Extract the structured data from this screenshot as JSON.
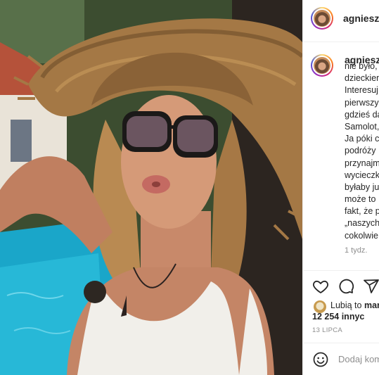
{
  "post": {
    "username": "agnieszka",
    "caption_lines": [
      "nie było,",
      "dzieckiem",
      "Interesuj",
      "pierwszy",
      "gdzieś da",
      "Samolot,",
      "Ja póki c",
      "podróży",
      "przynajm",
      "wycieczk",
      "byłaby ju",
      "może to",
      "fakt, że p",
      "„naszych",
      "cokolwie"
    ],
    "time_ago": "1 tydz.",
    "likes_prefix": "Lubią to",
    "likes_name": "mar",
    "likes_count": "12 254 innyc",
    "date": "13 LIPCA",
    "comment_placeholder": "Dodaj kom"
  },
  "icons": {
    "like": "heart-icon",
    "comment": "comment-icon",
    "share": "share-icon",
    "emoji": "emoji-icon"
  },
  "colors": {
    "text": "#262626",
    "muted": "#8e8e8e",
    "divider": "#efefef",
    "story_ring_start": "#feda75",
    "story_ring_end": "#962fbf"
  }
}
